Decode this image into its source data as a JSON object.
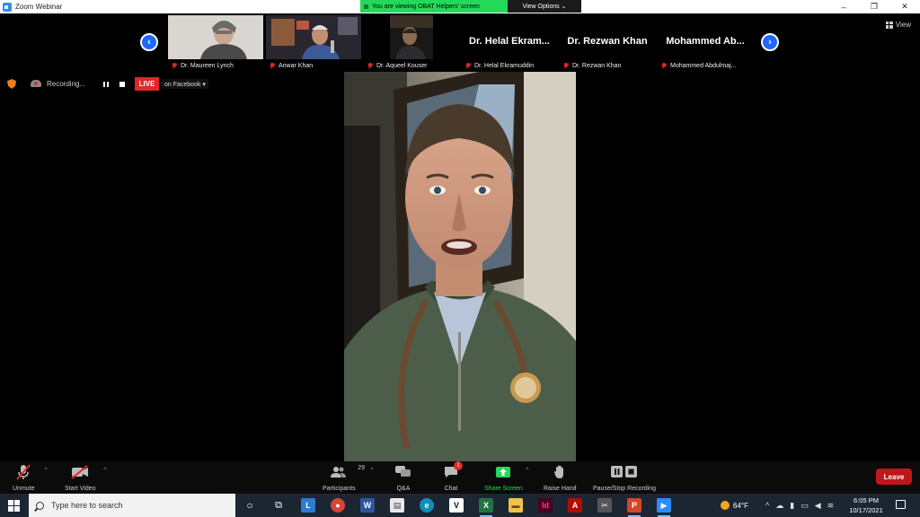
{
  "window": {
    "title": "Zoom Webinar",
    "controls": [
      "–",
      "❐",
      "✕"
    ]
  },
  "share_banner": {
    "viewing_text": "You are viewing OBAT Helpers' screen",
    "view_options": "View Options ⌄"
  },
  "participants": [
    {
      "display": "video",
      "name": "Dr. Maureen Lynch"
    },
    {
      "display": "video",
      "name": "Anwar Khan"
    },
    {
      "display": "video",
      "name": "Dr. Aqueel  Kouser"
    },
    {
      "display": "name",
      "big_name": "Dr. Helal Ekram...",
      "name": "Dr. Helal Ekramuddin"
    },
    {
      "display": "name",
      "big_name": "Dr. Rezwan Khan",
      "name": "Dr. Rezwan Khan"
    },
    {
      "display": "name",
      "big_name": "Mohammed  Ab...",
      "name": "Mohammed Abdulmaj..."
    }
  ],
  "view_button": "View",
  "recording": {
    "status": "Recording...",
    "live": "LIVE",
    "target": "on Facebook ▾"
  },
  "toolbar": {
    "unmute": "Unmute",
    "start_video": "Start Video",
    "participants": "Participants",
    "participant_count": "29",
    "qa": "Q&A",
    "chat": "Chat",
    "chat_badge": "1",
    "share_screen": "Share Screen",
    "raise_hand": "Raise Hand",
    "pause_stop": "Pause/Stop Recording",
    "leave": "Leave"
  },
  "taskbar": {
    "search_placeholder": "Type here to search",
    "apps": [
      {
        "name": "cortana-icon",
        "glyph": "○",
        "color": "transparent"
      },
      {
        "name": "task-view-icon",
        "glyph": "⧉",
        "color": "transparent"
      },
      {
        "name": "app-l-icon",
        "glyph": "L",
        "color": "#2b7cd3"
      },
      {
        "name": "chrome-icon",
        "glyph": "●",
        "color": "#db4437"
      },
      {
        "name": "word-icon",
        "glyph": "W",
        "color": "#2b579a"
      },
      {
        "name": "file-icon",
        "glyph": "▤",
        "color": "#e8e8e8"
      },
      {
        "name": "edge-icon",
        "glyph": "e",
        "color": "#0f8fb8"
      },
      {
        "name": "vnote-icon",
        "glyph": "V",
        "color": "#ffffff"
      },
      {
        "name": "excel-icon",
        "glyph": "X",
        "color": "#217346"
      },
      {
        "name": "explorer-icon",
        "glyph": "▬",
        "color": "#f0c24a"
      },
      {
        "name": "indesign-icon",
        "glyph": "Id",
        "color": "#49021f"
      },
      {
        "name": "acrobat-icon",
        "glyph": "A",
        "color": "#b30b00"
      },
      {
        "name": "snip-icon",
        "glyph": "✂",
        "color": "#555555"
      },
      {
        "name": "powerpoint-icon",
        "glyph": "P",
        "color": "#d24726"
      },
      {
        "name": "zoom-icon",
        "glyph": "▶",
        "color": "#2d8cff"
      }
    ],
    "weather": "64°F",
    "time": "6:05 PM",
    "date": "10/17/2021"
  },
  "colors": {
    "banner_green": "#23d959",
    "live_red": "#e02828",
    "leave_red": "#c0161a",
    "nav_blue": "#1f66ff",
    "share_green": "#23d959"
  }
}
